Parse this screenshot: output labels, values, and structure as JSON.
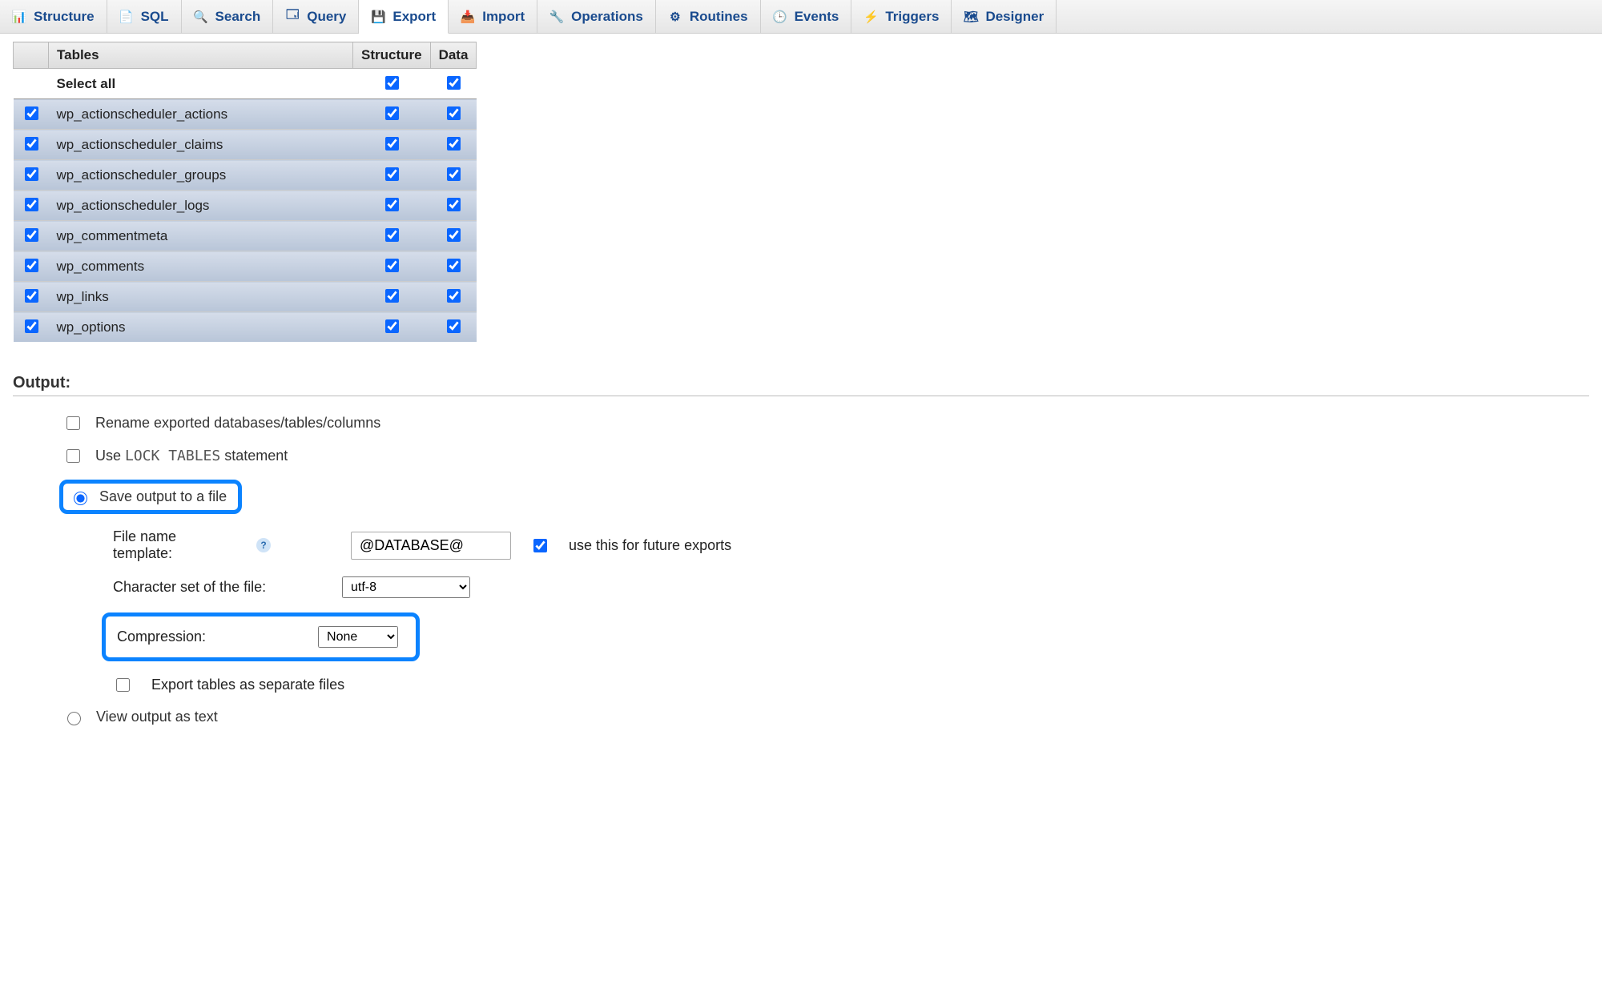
{
  "tabs": [
    {
      "label": "Structure",
      "icon": "structure-icon"
    },
    {
      "label": "SQL",
      "icon": "sql-icon"
    },
    {
      "label": "Search",
      "icon": "search-icon"
    },
    {
      "label": "Query",
      "icon": "query-icon"
    },
    {
      "label": "Export",
      "icon": "export-icon",
      "active": true
    },
    {
      "label": "Import",
      "icon": "import-icon"
    },
    {
      "label": "Operations",
      "icon": "operations-icon"
    },
    {
      "label": "Routines",
      "icon": "routines-icon"
    },
    {
      "label": "Events",
      "icon": "events-icon"
    },
    {
      "label": "Triggers",
      "icon": "triggers-icon"
    },
    {
      "label": "Designer",
      "icon": "designer-icon"
    }
  ],
  "columns": {
    "tables": "Tables",
    "structure": "Structure",
    "data": "Data"
  },
  "select_all_label": "Select all",
  "select_all": {
    "structure": true,
    "data": true
  },
  "rows": [
    {
      "name": "wp_actionscheduler_actions",
      "checked": true,
      "structure": true,
      "data": true
    },
    {
      "name": "wp_actionscheduler_claims",
      "checked": true,
      "structure": true,
      "data": true
    },
    {
      "name": "wp_actionscheduler_groups",
      "checked": true,
      "structure": true,
      "data": true
    },
    {
      "name": "wp_actionscheduler_logs",
      "checked": true,
      "structure": true,
      "data": true
    },
    {
      "name": "wp_commentmeta",
      "checked": true,
      "structure": true,
      "data": true
    },
    {
      "name": "wp_comments",
      "checked": true,
      "structure": true,
      "data": true
    },
    {
      "name": "wp_links",
      "checked": true,
      "structure": true,
      "data": true
    },
    {
      "name": "wp_options",
      "checked": true,
      "structure": true,
      "data": true
    }
  ],
  "output": {
    "heading": "Output:",
    "rename_label": "Rename exported databases/tables/columns",
    "rename_checked": false,
    "lock_tables_prefix": "Use ",
    "lock_tables_code": "LOCK TABLES",
    "lock_tables_suffix": " statement",
    "lock_tables_checked": false,
    "save_to_file_label": "Save output to a file",
    "save_to_file_selected": true,
    "file_template_label": "File name template:",
    "file_template_value": "@DATABASE@",
    "future_exports_label": "use this for future exports",
    "future_exports_checked": true,
    "charset_label": "Character set of the file:",
    "charset_value": "utf-8",
    "compression_label": "Compression:",
    "compression_value": "None",
    "separate_files_label": "Export tables as separate files",
    "separate_files_checked": false,
    "view_as_text_label": "View output as text",
    "view_as_text_selected": false
  }
}
